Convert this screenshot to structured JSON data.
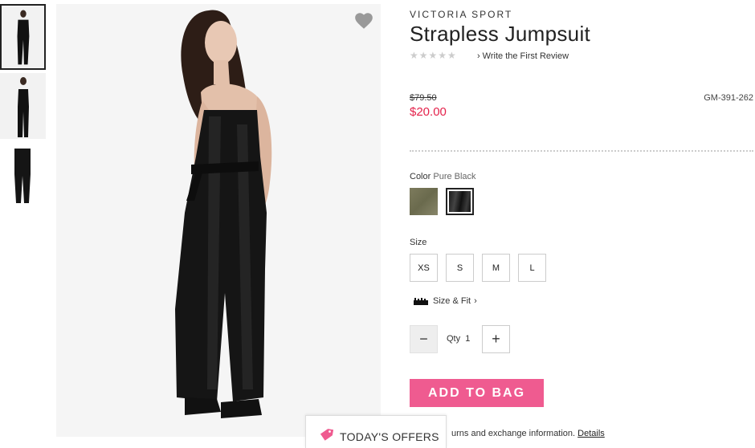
{
  "brand": "VICTORIA SPORT",
  "product": {
    "title": "Strapless Jumpsuit",
    "rating_stars": "★★★★★",
    "review_link": "Write the First Review",
    "old_price": "$79.50",
    "sale_price": "$20.00",
    "sku": "GM-391-262"
  },
  "color": {
    "label": "Color",
    "selected": "Pure Black",
    "options": [
      "Olive",
      "Pure Black"
    ]
  },
  "size": {
    "label": "Size",
    "options": [
      "XS",
      "S",
      "M",
      "L"
    ],
    "fit_link": "Size & Fit"
  },
  "quantity": {
    "label": "Qty",
    "value": "1",
    "minus": "−",
    "plus": "+"
  },
  "cta": {
    "add_to_bag": "ADD TO BAG"
  },
  "returns": {
    "text": "urns and exchange information.",
    "link": "Details"
  },
  "offers": {
    "label": "TODAY'S OFFERS"
  },
  "colors": {
    "sale": "#e4224b",
    "cta": "#ef5b90",
    "heart": "#999999"
  },
  "icons": {
    "favorite": "heart-icon",
    "ruler": "ruler-icon",
    "tag": "tag-icon"
  }
}
